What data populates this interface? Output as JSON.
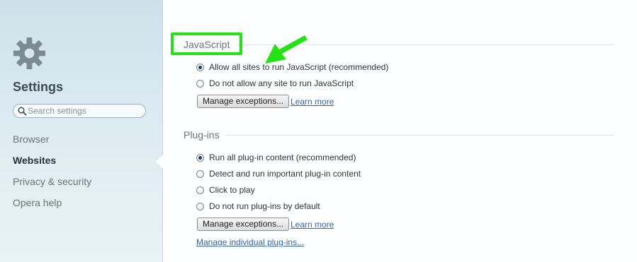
{
  "sidebar": {
    "title": "Settings",
    "search_placeholder": "Search settings",
    "nav": [
      {
        "label": "Browser"
      },
      {
        "label": "Websites"
      },
      {
        "label": "Privacy & security"
      },
      {
        "label": "Opera help"
      }
    ],
    "active": "Websites"
  },
  "javascript": {
    "title": "JavaScript",
    "options": [
      {
        "label": "Allow all sites to run JavaScript (recommended)",
        "checked": true
      },
      {
        "label": "Do not allow any site to run JavaScript",
        "checked": false
      }
    ],
    "manage_button": "Manage exceptions...",
    "learn_more": "Learn more"
  },
  "plugins": {
    "title": "Plug-ins",
    "options": [
      {
        "label": "Run all plug-in content (recommended)",
        "checked": true
      },
      {
        "label": "Detect and run important plug-in content",
        "checked": false
      },
      {
        "label": "Click to play",
        "checked": false
      },
      {
        "label": "Do not run plug-ins by default",
        "checked": false
      }
    ],
    "manage_button": "Manage exceptions...",
    "learn_more": "Learn more",
    "manage_individual": "Manage individual plug-ins..."
  },
  "colors": {
    "highlight": "#25e214",
    "link": "#3663b4",
    "sidebar_bg": "#dcebf1"
  }
}
